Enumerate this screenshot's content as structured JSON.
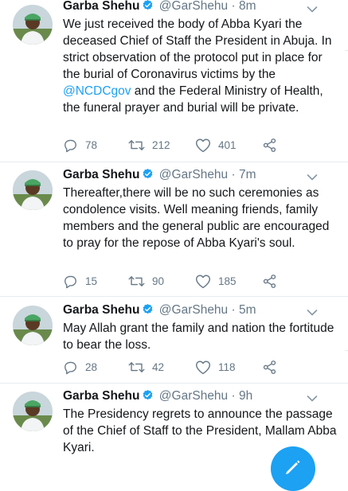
{
  "tweets": [
    {
      "author": "Garba Shehu",
      "handle": "@GarShehu",
      "separator": "·",
      "time": "8m",
      "text_before": "We just received the body of Abba Kyari the deceased Chief of Staff the President in Abuja. In strict observation of the protocol put in place for the burial of Coronavirus victims by the ",
      "mention": "@NCDCgov",
      "text_after": " and the Federal Ministry of Health, the funeral prayer and burial will be private.",
      "replies": "78",
      "retweets": "212",
      "likes": "401"
    },
    {
      "author": "Garba Shehu",
      "handle": "@GarShehu",
      "separator": "·",
      "time": "7m",
      "text": "Thereafter,there will be no such ceremonies as condolence visits. Well meaning friends, family members and the general public are encouraged to pray for the repose of Abba Kyari's soul.",
      "replies": "15",
      "retweets": "90",
      "likes": "185"
    },
    {
      "author": "Garba Shehu",
      "handle": "@GarShehu",
      "separator": "·",
      "time": "5m",
      "text": "May Allah grant the family and nation the fortitude to bear the loss.",
      "replies": "28",
      "retweets": "42",
      "likes": "118"
    },
    {
      "author": "Garba Shehu",
      "handle": "@GarShehu",
      "separator": "·",
      "time": "9h",
      "text": "The Presidency regrets to announce the passage of the Chief of Staff to the President, Mallam Abba Kyari."
    }
  ],
  "icons": {
    "verified": "verified-badge-icon",
    "menu": "chevron-down-icon",
    "reply": "reply-icon",
    "retweet": "retweet-icon",
    "like": "heart-icon",
    "share": "share-icon",
    "compose": "compose-tweet-icon"
  },
  "colors": {
    "accent": "#1da1f2",
    "text": "#14171a",
    "secondary": "#657786",
    "divider": "#e6ecf0"
  }
}
